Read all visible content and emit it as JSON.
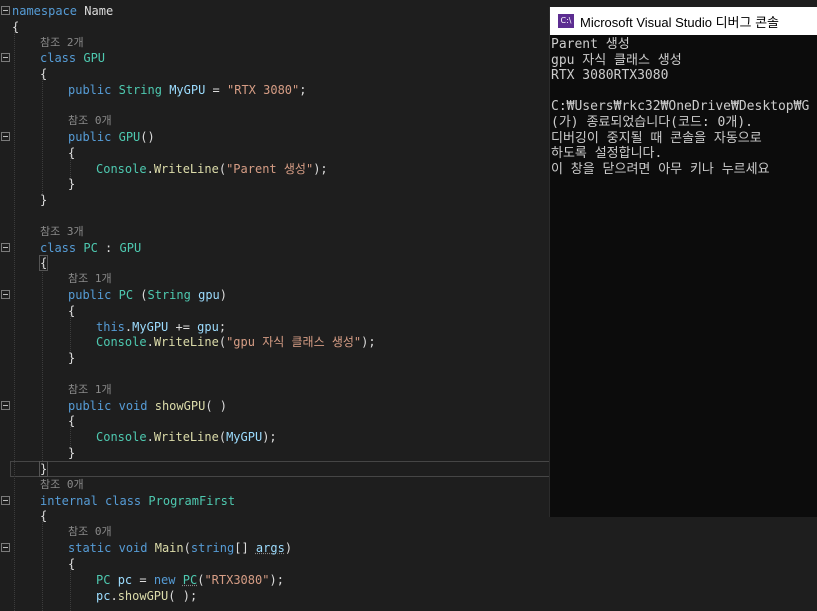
{
  "editor": {
    "lines": [
      {
        "indent": 0,
        "parts": [
          [
            "kw",
            "namespace"
          ],
          [
            "",
            "&nbsp;"
          ],
          [
            "",
            "Name"
          ]
        ]
      },
      {
        "indent": 0,
        "parts": [
          [
            "",
            "{"
          ]
        ]
      }
    ],
    "hint_refs_2": "참조 2개",
    "hint_refs_0": "참조 0개",
    "hint_refs_3": "참조 3개",
    "hint_refs_1": "참조 1개",
    "kw_namespace": "namespace",
    "ns_name": "Name",
    "brace_open": "{",
    "brace_close": "}",
    "kw_class": "class",
    "class_gpu": "GPU",
    "kw_public": "public",
    "type_string": "String",
    "field_mygpu": "MyGPU",
    "op_assign": " = ",
    "str_rtx3080_q": "\"RTX 3080\"",
    "semi": ";",
    "ctor_gpu": "GPU",
    "parens": "()",
    "console_cls": "Console",
    "writeline": "WriteLine",
    "str_parent": "\"Parent 생성\"",
    "class_pc": "PC",
    "colon_base": " : ",
    "ctor_pc": "PC",
    "param_gpu": "gpu",
    "kw_this": "this",
    "str_child": "\"gpu 자식 클래스 생성\"",
    "kw_void": "void",
    "fn_showgpu": "showGPU",
    "kw_internal": "internal",
    "class_programfirst": "ProgramFirst",
    "kw_static": "static",
    "fn_main": "Main",
    "type_string_lower": "string",
    "arr_brackets": "[]",
    "param_args": "args",
    "var_pc": "pc",
    "kw_new": "new",
    "str_rtx3080": "\"RTX3080\""
  },
  "console": {
    "title": "Microsoft Visual Studio 디버그 콘솔",
    "icon_text": "C:\\",
    "lines": [
      "Parent 생성",
      "gpu 자식 클래스 생성",
      "RTX 3080RTX3080",
      "",
      "C:₩Users₩rkc32₩OneDrive₩Desktop₩G",
      "(가) 종료되었습니다(코드: 0개).",
      "디버깅이 중지될 때 콘솔을 자동으로",
      "하도록 설정합니다.",
      "이 창을 닫으려면 아무 키나 누르세요"
    ]
  },
  "colors": {
    "editor_bg": "#1e1e1e",
    "keyword": "#569cd6",
    "type": "#4ec9b0",
    "string": "#d69d85",
    "method": "#dcdcaa",
    "identifier": "#9cdcfe",
    "console_bg": "#0c0c0c"
  }
}
